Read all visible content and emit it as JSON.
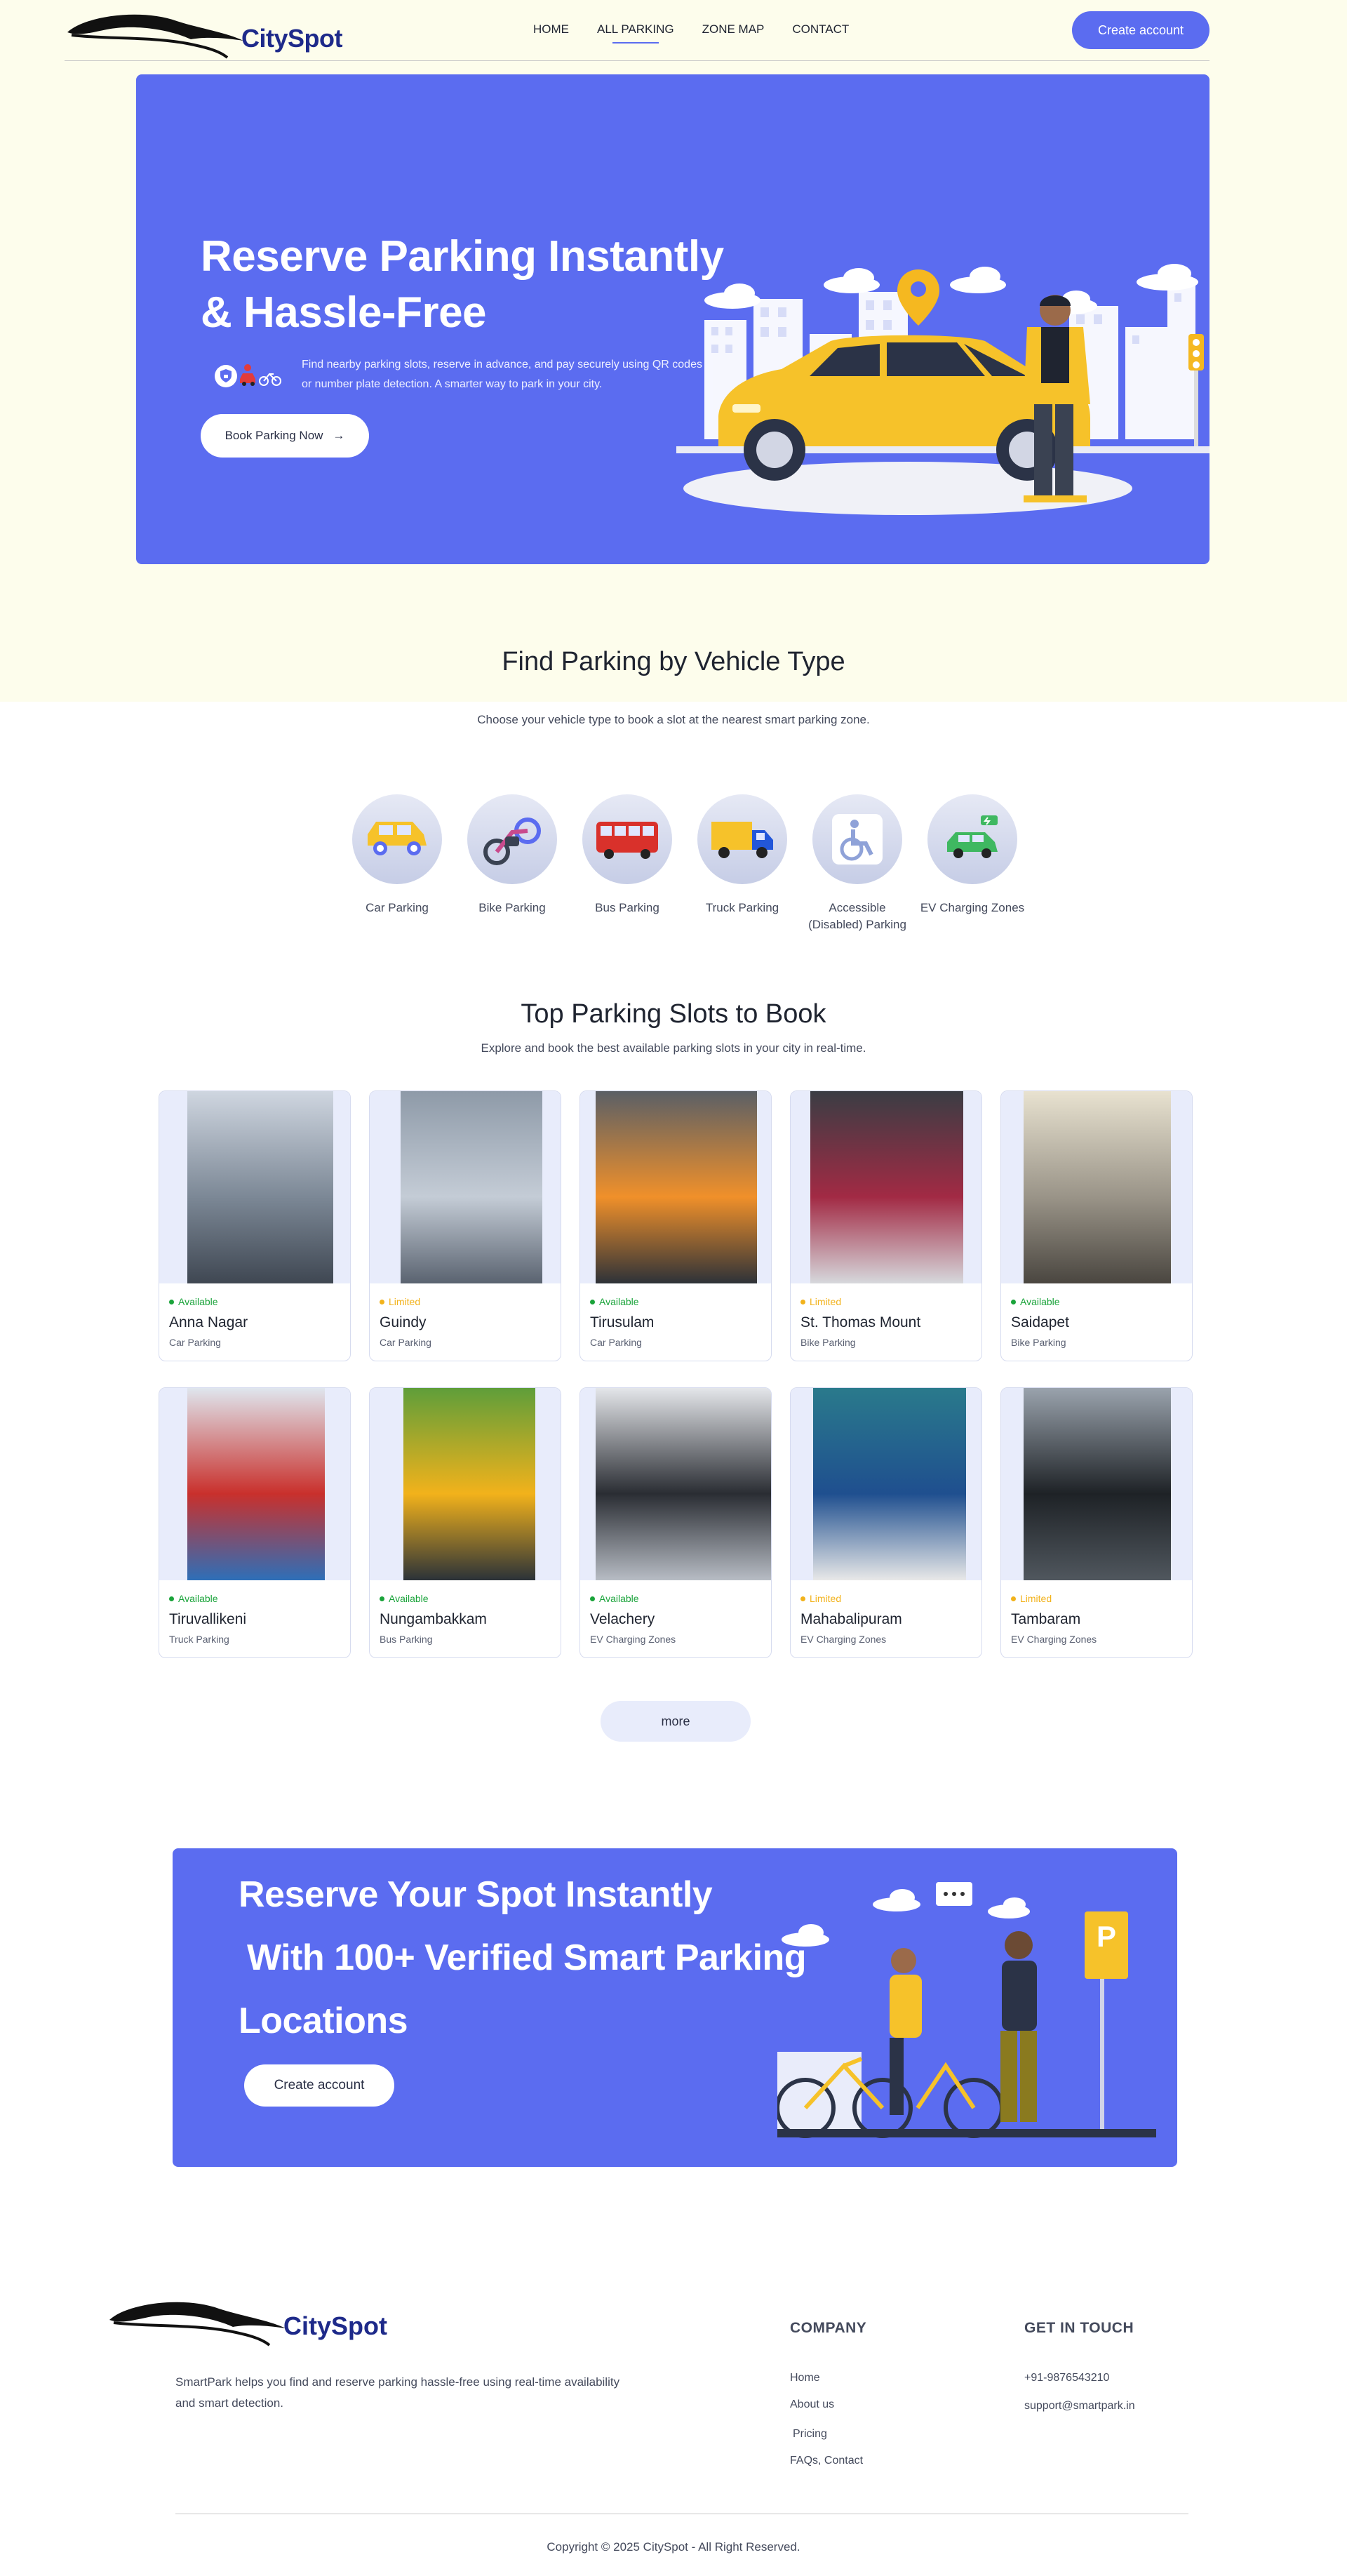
{
  "header": {
    "logo_text": "CitySpot",
    "nav": [
      "HOME",
      "ALL PARKING",
      "ZONE MAP",
      "CONTACT"
    ],
    "active_nav": "ALL PARKING",
    "create_account": "Create account"
  },
  "hero": {
    "title_line1": "Reserve Parking Instantly",
    "title_line2": "& Hassle-Free",
    "description": "Find nearby parking slots, reserve in advance, and pay securely using QR codes or number plate detection. A smarter way to park in your city.",
    "cta": "Book Parking Now"
  },
  "vehicle_types": {
    "title": "Find Parking by Vehicle Type",
    "subtitle": "Choose your vehicle type to book a slot at the nearest smart parking zone.",
    "items": [
      {
        "label": "Car Parking",
        "icon": "car-icon"
      },
      {
        "label": "Bike Parking",
        "icon": "bike-icon"
      },
      {
        "label": "Bus Parking",
        "icon": "bus-icon"
      },
      {
        "label": "Truck Parking",
        "icon": "truck-icon"
      },
      {
        "label": "Accessible (Disabled) Parking",
        "icon": "wheelchair-icon"
      },
      {
        "label": "EV Charging Zones",
        "icon": "ev-car-icon"
      }
    ]
  },
  "top_slots": {
    "title": "Top Parking Slots to Book",
    "subtitle": "Explore and book the best available parking slots in your city in real-time.",
    "cards": [
      {
        "status": "Available",
        "name": "Anna Nagar",
        "type": "Car Parking"
      },
      {
        "status": "Limited",
        "name": "Guindy",
        "type": "Car Parking"
      },
      {
        "status": "Available",
        "name": "Tirusulam",
        "type": "Car Parking"
      },
      {
        "status": "Limited",
        "name": "St. Thomas Mount",
        "type": "Bike Parking"
      },
      {
        "status": "Available",
        "name": "Saidapet",
        "type": "Bike Parking"
      },
      {
        "status": "Available",
        "name": "Tiruvallikeni",
        "type": "Truck Parking"
      },
      {
        "status": "Available",
        "name": "Nungambakkam",
        "type": "Bus Parking"
      },
      {
        "status": "Available",
        "name": "Velachery",
        "type": "EV Charging Zones"
      },
      {
        "status": "Limited",
        "name": "Mahabalipuram",
        "type": "EV Charging Zones"
      },
      {
        "status": "Limited",
        "name": "Tambaram",
        "type": "EV Charging Zones"
      }
    ],
    "more": "more"
  },
  "status_colors": {
    "Available": "#1aa33a",
    "Limited": "#f2b21b"
  },
  "cta": {
    "line1": "Reserve Your Spot Instantly",
    "line2": "With 100+ Verified Smart Parking",
    "line3": "Locations",
    "button": "Create account"
  },
  "footer": {
    "logo_text": "CitySpot",
    "description": "SmartPark helps you find and reserve parking hassle-free using real-time availability and smart detection.",
    "company_title": "COMPANY",
    "company_links": [
      "Home",
      "About us",
      "Pricing",
      "FAQs, Contact"
    ],
    "contact_title": "GET IN TOUCH",
    "phone": "+91-9876543210",
    "email": "support@smartpark.in",
    "copyright": "Copyright © 2025 CitySpot - All Right Reserved."
  },
  "colors": {
    "accent": "#5b6cf0",
    "brand": "#1e2a8a",
    "cream": "#fdfdec"
  }
}
